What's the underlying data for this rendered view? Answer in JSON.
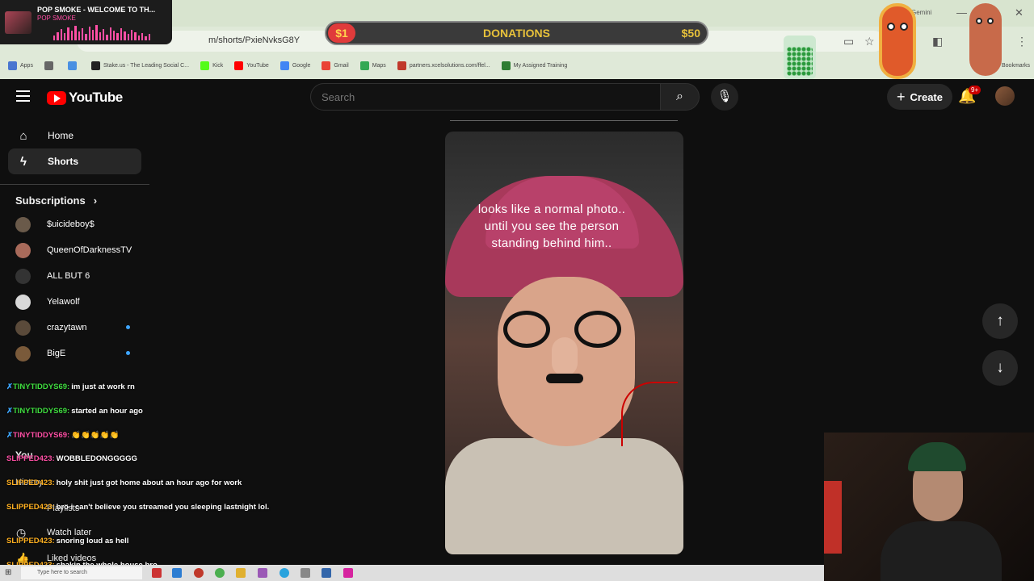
{
  "browser": {
    "url": "m/shorts/PxieNvksG8Y",
    "profile": "Gemini",
    "bookmarks_label": "Bookmarks",
    "bookmarks": [
      {
        "label": "Apps",
        "color": "#4a76d0"
      },
      {
        "label": "",
        "color": "#666666"
      },
      {
        "label": "",
        "color": "#4a90e2"
      },
      {
        "label": "Stake.us - The Leading Social C...",
        "color": "#222222"
      },
      {
        "label": "Kick",
        "color": "#53fc18"
      },
      {
        "label": "YouTube",
        "color": "#ff0000"
      },
      {
        "label": "Google",
        "color": "#4285f4"
      },
      {
        "label": "Gmail",
        "color": "#ea4335"
      },
      {
        "label": "Maps",
        "color": "#34a853"
      },
      {
        "label": "partners.xcelsolutions.com/ffel...",
        "color": "#c0392b"
      },
      {
        "label": "My Assigned Training",
        "color": "#2e7d32"
      }
    ]
  },
  "music_overlay": {
    "title": "POP SMOKE - WELCOME TO TH...",
    "artist": "POP SMOKE"
  },
  "donations": {
    "current": "$1",
    "label": "DONATIONS",
    "goal": "$50"
  },
  "header": {
    "logo_text": "YouTube",
    "search_placeholder": "Search",
    "create_label": "Create",
    "notification_count": "9+"
  },
  "sidebar": {
    "items": [
      {
        "label": "Home"
      },
      {
        "label": "Shorts"
      }
    ],
    "subscriptions_title": "Subscriptions",
    "subscriptions": [
      {
        "name": "$uicideboy$",
        "live": false,
        "color": "#6a5a4a"
      },
      {
        "name": "QueenOfDarknessTV",
        "live": false,
        "color": "#a86a5a"
      },
      {
        "name": "ALL BUT 6",
        "live": false,
        "color": "#333333"
      },
      {
        "name": "Yelawolf",
        "live": false,
        "color": "#d8d8d8"
      },
      {
        "name": "crazytawn",
        "live": true,
        "color": "#5a4a3a"
      },
      {
        "name": "BigE",
        "live": true,
        "color": "#7a5a3a"
      }
    ],
    "you_title": "You",
    "you_items": [
      {
        "label": "History"
      },
      {
        "label": "Playlists"
      },
      {
        "label": "Watch later"
      },
      {
        "label": "Liked videos"
      }
    ]
  },
  "chat": [
    {
      "user": "TINYTIDDYS69:",
      "message": "im just at work rn",
      "color": "#3fdc3f",
      "badge": true
    },
    {
      "user": "TINYTIDDYS69:",
      "message": "started an hour ago",
      "color": "#3fdc3f",
      "badge": true
    },
    {
      "user": "TINYTIDDYS69:",
      "message": "👏👏👏👏👏",
      "color": "#ff4fa5",
      "badge": true
    },
    {
      "user": "SLIPPED423:",
      "message": "WOBBLEDONGGGGG",
      "color": "#ff4fa5",
      "badge": false
    },
    {
      "user": "SLIPPED423:",
      "message": "holy shit just got home about an hour ago for work",
      "color": "#ffb020",
      "badge": false
    },
    {
      "user": "SLIPPED423:",
      "message": "bro i can't believe you streamed you sleeping lastnight lol.",
      "color": "#ffb020",
      "badge": false
    },
    {
      "user": "SLIPPED423:",
      "message": "snoring loud as hell",
      "color": "#ffb020",
      "badge": false
    },
    {
      "user": "SLIPPED423:",
      "message": "shakin the whole house bro",
      "color": "#ffb020",
      "badge": false
    }
  ],
  "short": {
    "caption": "looks like a normal photo.. until you see the person standing behind him.."
  },
  "taskbar": {
    "search_placeholder": "Type here to search"
  }
}
